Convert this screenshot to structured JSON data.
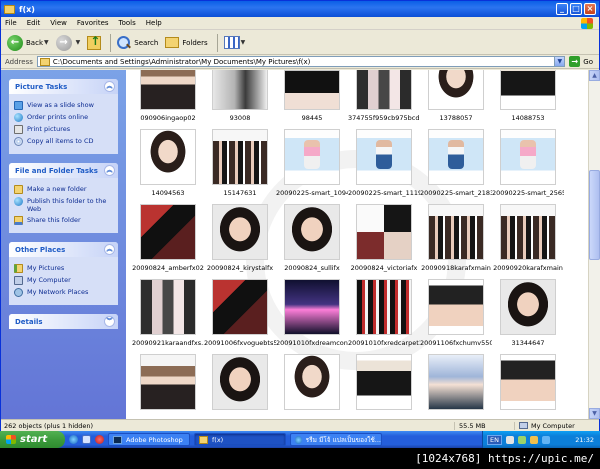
{
  "window": {
    "title": "f(x)",
    "buttons": {
      "minimize": "_",
      "maximize": "□",
      "close": "×"
    }
  },
  "menu": [
    "File",
    "Edit",
    "View",
    "Favorites",
    "Tools",
    "Help"
  ],
  "toolbar": {
    "back": "Back",
    "search": "Search",
    "folders": "Folders"
  },
  "address": {
    "label": "Address",
    "value": "C:\\Documents and Settings\\Administrator\\My Documents\\My Pictures\\f(x)",
    "go": "Go"
  },
  "taskpane": {
    "picture_tasks": {
      "title": "Picture Tasks",
      "items": [
        "View as a slide show",
        "Order prints online",
        "Print pictures",
        "Copy all items to CD"
      ]
    },
    "file_folder_tasks": {
      "title": "File and Folder Tasks",
      "items": [
        "Make a new folder",
        "Publish this folder to the Web",
        "Share this folder"
      ]
    },
    "other_places": {
      "title": "Other Places",
      "items": [
        "My Pictures",
        "My Computer",
        "My Network Places"
      ]
    },
    "details": {
      "title": "Details"
    }
  },
  "files": [
    {
      "name": "090906ingaop02",
      "style": "p1"
    },
    {
      "name": "93008",
      "style": "p2"
    },
    {
      "name": "98445",
      "style": "p3"
    },
    {
      "name": "374755f959cb975bcd...",
      "style": "p4"
    },
    {
      "name": "13788057",
      "style": "p5"
    },
    {
      "name": "14088753",
      "style": "p6"
    },
    {
      "name": "14094563",
      "style": "p5"
    },
    {
      "name": "15147631",
      "style": "grp"
    },
    {
      "name": "20090225-smart_1094...",
      "style": "smart pink"
    },
    {
      "name": "20090225-smart_1119...",
      "style": "smart"
    },
    {
      "name": "20090225-smart_2183...",
      "style": "smart"
    },
    {
      "name": "20090225-smart_2565...",
      "style": "smart pink"
    },
    {
      "name": "20090824_amberfx02",
      "style": "dark1"
    },
    {
      "name": "20090824_kirystalfx",
      "style": "face"
    },
    {
      "name": "20090824_sullifx",
      "style": "face"
    },
    {
      "name": "20090824_victoriafx",
      "style": "collage"
    },
    {
      "name": "20090918karafxmain",
      "style": "grp"
    },
    {
      "name": "20090920karafxmain",
      "style": "grp"
    },
    {
      "name": "20090921karaandfxs...",
      "style": "p4"
    },
    {
      "name": "20091006fxvoguebts572",
      "style": "dark1"
    },
    {
      "name": "20091010fxdreamcon...",
      "style": "stage"
    },
    {
      "name": "20091010fxredcarpet1",
      "style": "dark3"
    },
    {
      "name": "20091106fxchumv550",
      "style": "legs"
    },
    {
      "name": "31344647",
      "style": "face"
    },
    {
      "name": "",
      "style": "p1"
    },
    {
      "name": "",
      "style": "face"
    },
    {
      "name": "",
      "style": "p5"
    },
    {
      "name": "",
      "style": "p6"
    },
    {
      "name": "",
      "style": "blue"
    },
    {
      "name": "",
      "style": "legs"
    }
  ],
  "status": {
    "objects": "262 objects (plus 1 hidden)",
    "size": "55.5 MB",
    "zone": "My Computer"
  },
  "taskbar": {
    "start": "start",
    "tasks": [
      "Adobe Photoshop",
      "f(x)",
      "รรีม มีโจ้ แปลเป็นของใช้..."
    ],
    "lang": "EN",
    "clock": "21:32"
  },
  "footer_text": "[1024x768] https://upic.me/"
}
